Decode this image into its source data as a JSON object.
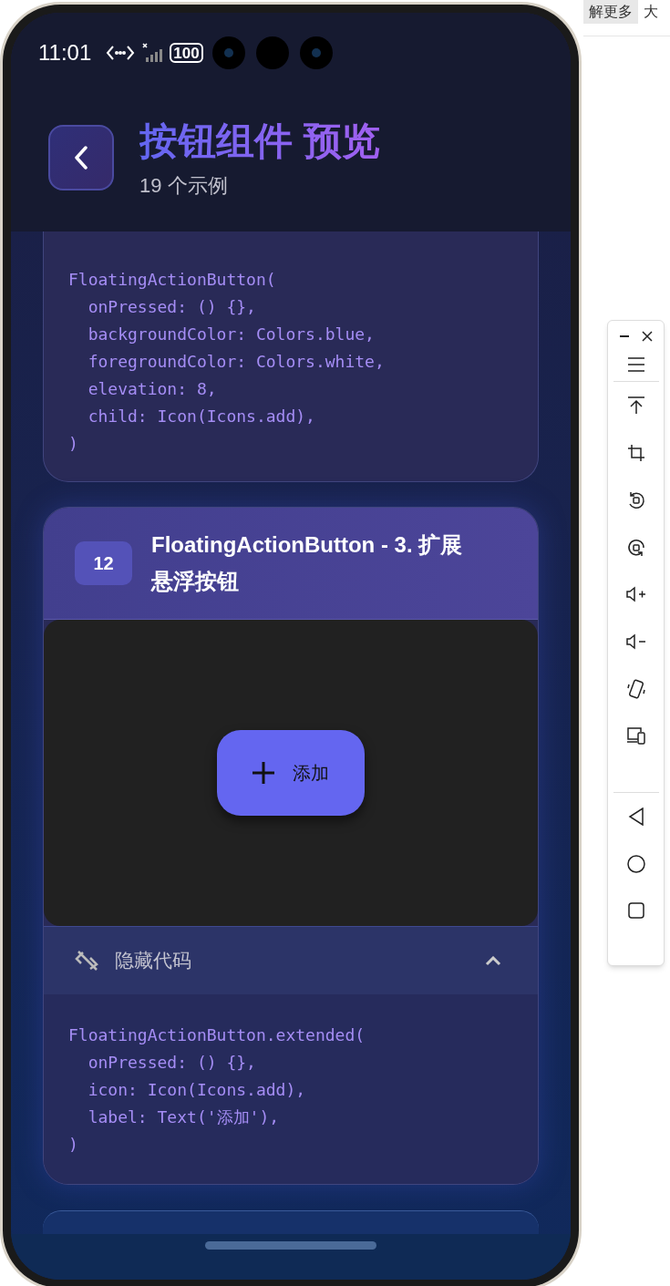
{
  "browser_tabs": [
    {
      "label": "解更多",
      "selected": true
    },
    {
      "label": "大",
      "selected": false
    }
  ],
  "status_bar": {
    "time": "11:01",
    "battery": "100"
  },
  "header": {
    "title": "按钮组件 预览",
    "subtitle": "19 个示例"
  },
  "cards": [
    {
      "code": "FloatingActionButton(\n  onPressed: () {},\n  backgroundColor: Colors.blue,\n  foregroundColor: Colors.white,\n  elevation: 8,\n  child: Icon(Icons.add),\n)"
    },
    {
      "number": "12",
      "title": "FloatingActionButton - 3. 扩展悬浮按钮",
      "preview": {
        "button_label": "添加"
      },
      "code_toggle": {
        "label": "隐藏代码",
        "expanded": true
      },
      "code": "FloatingActionButton.extended(\n  onPressed: () {},\n  icon: Icon(Icons.add),\n  label: Text('添加'),\n)"
    }
  ]
}
